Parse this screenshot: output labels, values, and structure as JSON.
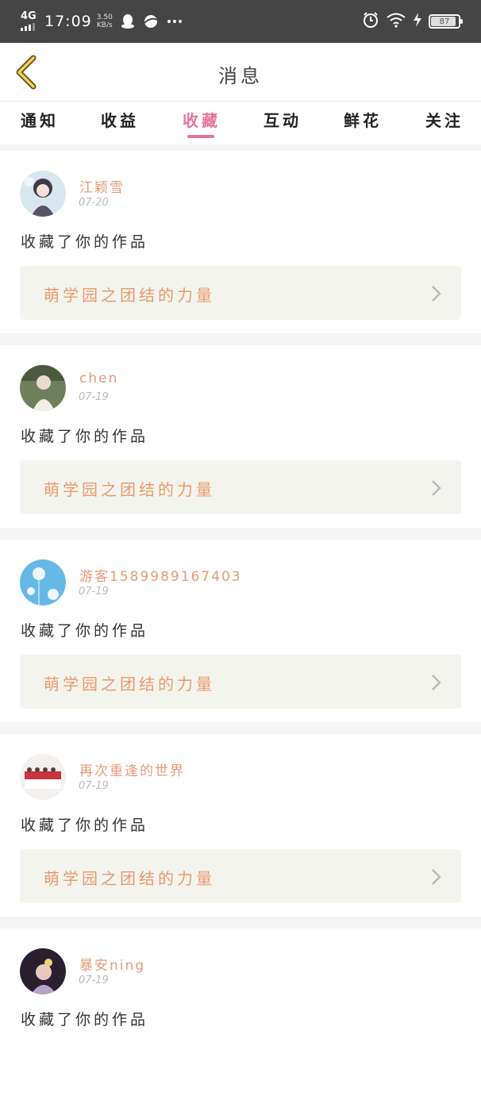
{
  "status_bar": {
    "network": "4G",
    "time": "17:09",
    "speed_value": "3.50",
    "speed_unit": "KB/s",
    "battery": "87",
    "icons": [
      "qq-icon",
      "browser-icon",
      "more-dots-icon",
      "alarm-icon",
      "wifi-icon",
      "charging-icon",
      "battery-icon"
    ]
  },
  "header": {
    "title": "消息",
    "back_icon": "chevron-left-icon"
  },
  "tabs": [
    {
      "label": "通知",
      "active": false
    },
    {
      "label": "收益",
      "active": false
    },
    {
      "label": "收藏",
      "active": true
    },
    {
      "label": "互动",
      "active": false
    },
    {
      "label": "鲜花",
      "active": false
    },
    {
      "label": "关注",
      "active": false
    }
  ],
  "colors": {
    "accent": "#e5749a",
    "username": "#e59a76",
    "work_title": "#ea9a6c",
    "work_bg": "#f4f4ee"
  },
  "notifications": [
    {
      "user": "江颖雪",
      "date": "07-20",
      "action": "收藏了你的作品",
      "work": "萌学园之团结的力量"
    },
    {
      "user": "chen",
      "date": "07-19",
      "action": "收藏了你的作品",
      "work": "萌学园之团结的力量"
    },
    {
      "user": "游客1589989167403",
      "date": "07-19",
      "action": "收藏了你的作品",
      "work": "萌学园之团结的力量"
    },
    {
      "user": "再次重逢的世界",
      "date": "07-19",
      "action": "收藏了你的作品",
      "work": "萌学园之团结的力量"
    },
    {
      "user": "暴安ning",
      "date": "07-19",
      "action": "收藏了你的作品",
      "work": ""
    }
  ]
}
